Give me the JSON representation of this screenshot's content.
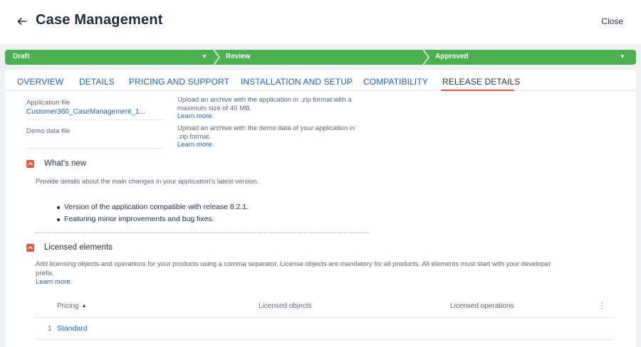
{
  "header": {
    "title": "Case Management",
    "close_label": "Close",
    "back_icon": "arrow-left-icon"
  },
  "stages": [
    {
      "label": "Draft",
      "status_color": "#4caf50"
    },
    {
      "label": "Review",
      "status_color": "#4caf50"
    },
    {
      "label": "Approved",
      "status_color": "#4caf50"
    }
  ],
  "tabs": [
    {
      "label": "OVERVIEW",
      "active": false
    },
    {
      "label": "DETAILS",
      "active": false
    },
    {
      "label": "PRICING AND SUPPORT",
      "active": false
    },
    {
      "label": "INSTALLATION AND SETUP",
      "active": false
    },
    {
      "label": "COMPATIBILITY",
      "active": false
    },
    {
      "label": "RELEASE DETAILS",
      "active": true
    }
  ],
  "files": {
    "app_file": {
      "label": "Application file",
      "value": "Customer360_CaseManagement_1...",
      "help_line1": "Upload an archive with the application in .zip format with a",
      "help_line2": "maximum size of 40 MB.",
      "learn_more": "Learn more."
    },
    "demo_file": {
      "label": "Demo data file",
      "help_line1": "Upload an archive with the demo data of your application in",
      "help_line2": ".zip format.",
      "learn_more": "Learn more."
    }
  },
  "whats_new": {
    "title": "What's new",
    "description": "Provide details about the main changes in your application's latest version.",
    "bullets": [
      "Version of the application compatible with release 8.2.1.",
      "Featuring minor improvements and bug fixes."
    ]
  },
  "licensed": {
    "title": "Licensed elements",
    "description_line1": "Add licensing objects and operations for your products using a comma separator. License objects are mandatory for all products. All elements must start with your developer",
    "description_line2": "prefix.",
    "learn_more": "Learn more.",
    "table": {
      "columns": [
        "Pricing",
        "Licensed objects",
        "Licensed operations"
      ],
      "rows": [
        {
          "num": "1",
          "pricing": "Standard",
          "objects": "",
          "operations": ""
        }
      ]
    }
  },
  "colors": {
    "accent": "#e2563a",
    "link": "#1c5fb8",
    "stage_green": "#4caf50"
  }
}
